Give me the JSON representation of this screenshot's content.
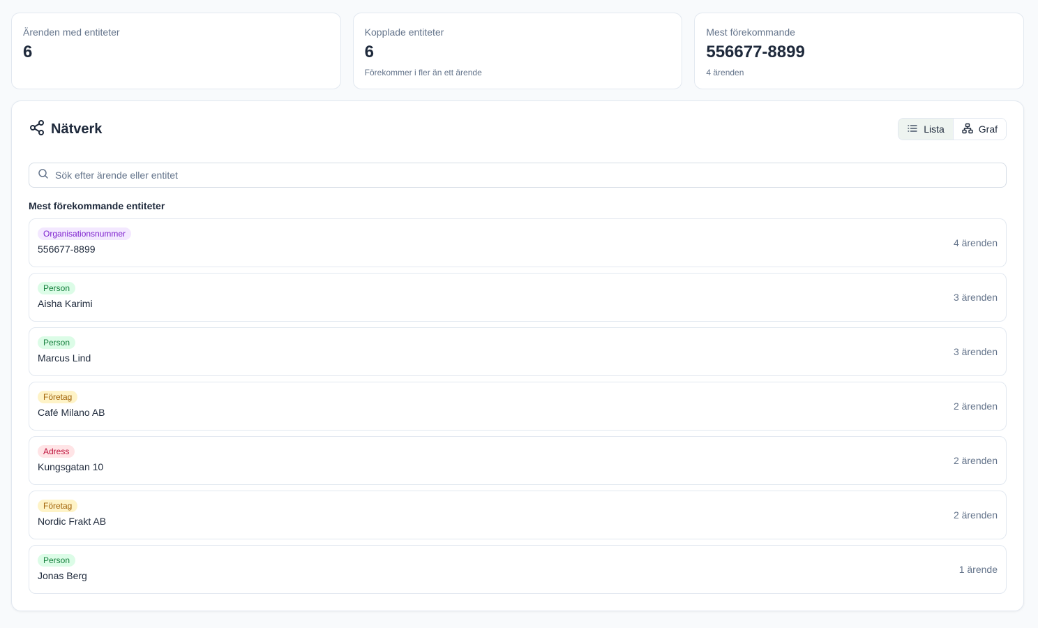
{
  "stats": [
    {
      "label": "Ärenden med entiteter",
      "value": "6",
      "sub": ""
    },
    {
      "label": "Kopplade entiteter",
      "value": "6",
      "sub": "Förekommer i fler än ett ärende"
    },
    {
      "label": "Mest förekommande",
      "value": "556677-8899",
      "sub": "4 ärenden"
    }
  ],
  "panel": {
    "title": "Nätverk",
    "title_icon": "share-network-icon",
    "toggle": {
      "list_label": "Lista",
      "graph_label": "Graf",
      "active": "list"
    },
    "search": {
      "placeholder": "Sök efter ärende eller entitet",
      "value": ""
    },
    "section_title": "Mest förekommande entiteter",
    "entities": [
      {
        "type": "Organisationsnummer",
        "type_key": "org",
        "name": "556677-8899",
        "count": "4 ärenden"
      },
      {
        "type": "Person",
        "type_key": "person",
        "name": "Aisha Karimi",
        "count": "3 ärenden"
      },
      {
        "type": "Person",
        "type_key": "person",
        "name": "Marcus Lind",
        "count": "3 ärenden"
      },
      {
        "type": "Företag",
        "type_key": "company",
        "name": "Café Milano AB",
        "count": "2 ärenden"
      },
      {
        "type": "Adress",
        "type_key": "address",
        "name": "Kungsgatan 10",
        "count": "2 ärenden"
      },
      {
        "type": "Företag",
        "type_key": "company",
        "name": "Nordic Frakt AB",
        "count": "2 ärenden"
      },
      {
        "type": "Person",
        "type_key": "person",
        "name": "Jonas Berg",
        "count": "1 ärende"
      }
    ]
  },
  "colors": {
    "org_badge_bg": "#f3e8ff",
    "org_badge_text": "#7e22ce",
    "person_badge_bg": "#dcfce7",
    "person_badge_text": "#15803d",
    "company_badge_bg": "#fef3c7",
    "company_badge_text": "#a16207",
    "address_badge_bg": "#ffe4e6",
    "address_badge_text": "#be123c",
    "toggle_active_bg": "#eef4f0"
  }
}
